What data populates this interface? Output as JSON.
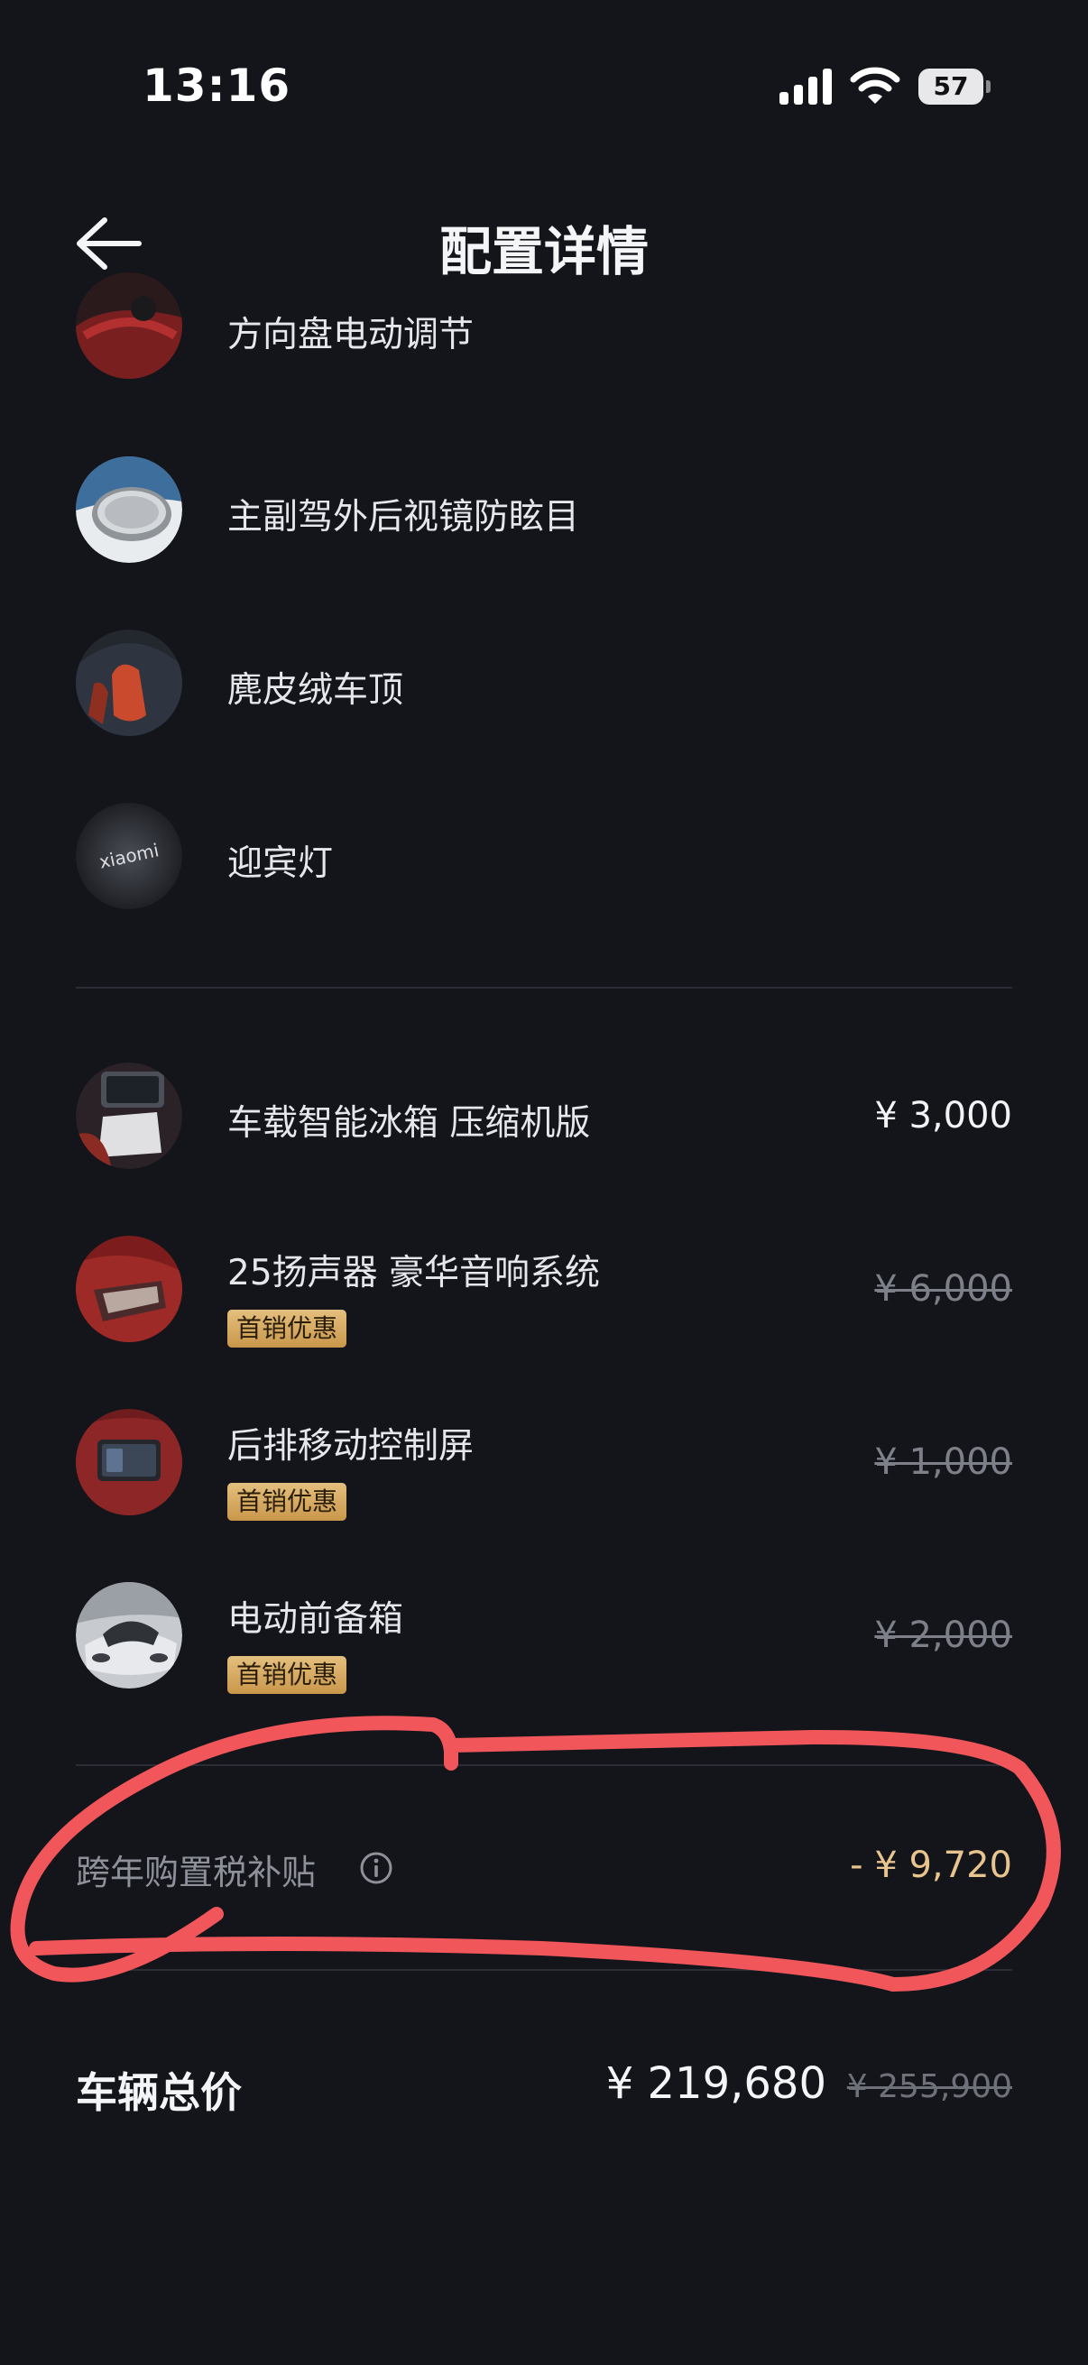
{
  "status_bar": {
    "time": "13:16",
    "battery": "57"
  },
  "header": {
    "title": "配置详情"
  },
  "included_items": [
    {
      "name": "方向盘电动调节",
      "icon": "steering-wheel-thumbnail"
    },
    {
      "name": "主副驾外后视镜防眩目",
      "icon": "side-mirror-thumbnail"
    },
    {
      "name": "麂皮绒车顶",
      "icon": "suede-roof-thumbnail"
    },
    {
      "name": "迎宾灯",
      "icon": "welcome-light-thumbnail",
      "logo_text": "xiaomi"
    }
  ],
  "paid_items": [
    {
      "name": "车载智能冰箱 压缩机版",
      "price": "¥ 3,000",
      "struck": false,
      "badge": ""
    },
    {
      "name": "25扬声器 豪华音响系统",
      "price": "¥ 6,000",
      "struck": true,
      "badge": "首销优惠"
    },
    {
      "name": "后排移动控制屏",
      "price": "¥ 1,000",
      "struck": true,
      "badge": "首销优惠"
    },
    {
      "name": "电动前备箱",
      "price": "¥ 2,000",
      "struck": true,
      "badge": "首销优惠"
    }
  ],
  "subsidy": {
    "label": "跨年购置税补贴",
    "value": "- ¥ 9,720"
  },
  "total": {
    "label": "车辆总价",
    "value": "¥ 219,680",
    "original": "¥ 255,900"
  },
  "colors": {
    "background": "#13151b",
    "accent_gold": "#e8c48e",
    "annotation_red": "#f0565a"
  }
}
